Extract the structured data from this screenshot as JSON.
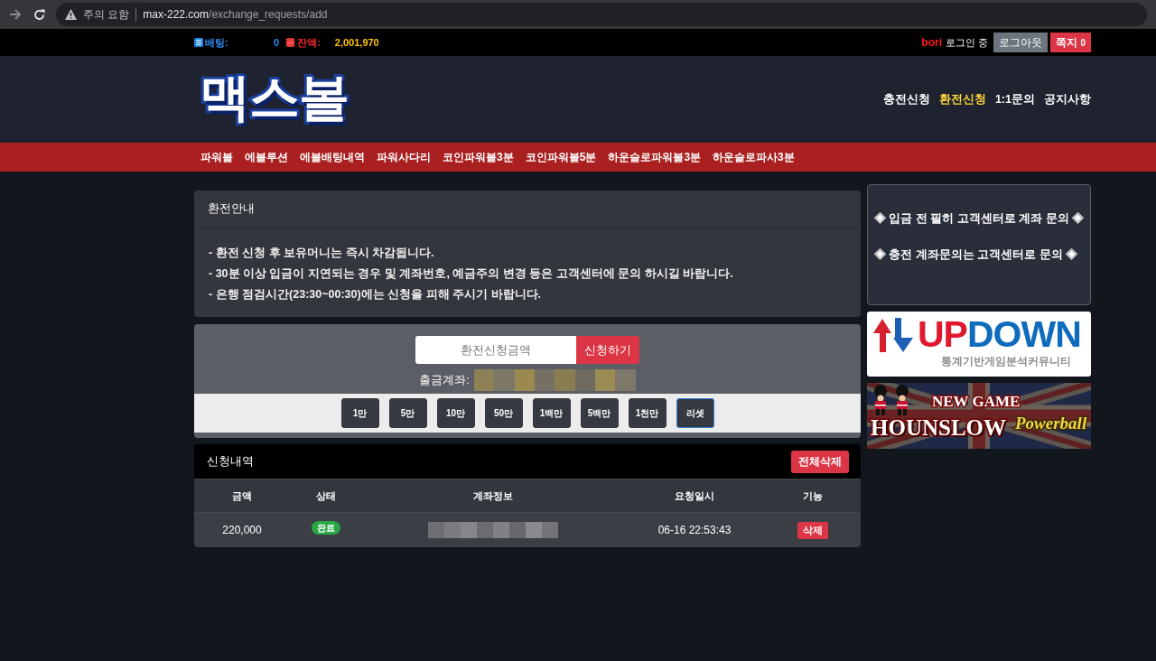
{
  "browser": {
    "security_label": "주의 요함",
    "url": {
      "host": "max-222.com",
      "path": "/exchange_requests/add"
    }
  },
  "top_bar": {
    "betting": {
      "label": "배팅:",
      "value": "0"
    },
    "balance": {
      "label": "잔액:",
      "value": "2,001,970"
    },
    "user": {
      "name": "bori",
      "status": "로그인 중"
    },
    "logout_button": "로그아웃",
    "messages_button": {
      "label": "쪽지",
      "count": "0"
    }
  },
  "header": {
    "logo": "맥스볼",
    "nav": [
      {
        "label": "충전신청",
        "selected": false
      },
      {
        "label": "환전신청",
        "selected": true
      },
      {
        "label": "1:1문의",
        "selected": false
      },
      {
        "label": "공지사항",
        "selected": false
      }
    ]
  },
  "menu": [
    "파워볼",
    "에볼루션",
    "에볼배팅내역",
    "파워사다리",
    "코인파워볼3분",
    "코인파워볼5분",
    "하운슬로파워볼3분",
    "하운슬로파사3분"
  ],
  "notice": {
    "title": "환전안내",
    "lines": [
      "- 환전 신청 후 보유머니는 즉시 차감됩니다.",
      "- 30분 이상 입금이 지연되는 경우 및 계좌번호, 예금주의 변경 등은 고객센터에 문의 하시길 바랍니다.",
      "- 은행 점검시간(23:30~00:30)에는 신청을 피해 주시기 바랍니다."
    ]
  },
  "exchange_form": {
    "amount_field": {
      "placeholder": "환전신청금액"
    },
    "submit_button": "신청하기",
    "account_label": "출금계좌:",
    "quick_buttons": [
      {
        "label": "1만",
        "kind": "amount"
      },
      {
        "label": "5만",
        "kind": "amount"
      },
      {
        "label": "10만",
        "kind": "amount"
      },
      {
        "label": "50만",
        "kind": "amount"
      },
      {
        "label": "1백만",
        "kind": "amount"
      },
      {
        "label": "5백만",
        "kind": "amount"
      },
      {
        "label": "1천만",
        "kind": "amount"
      },
      {
        "label": "리셋",
        "kind": "reset"
      }
    ]
  },
  "history": {
    "title": "신청내역",
    "delete_all_button": "전체삭제",
    "columns": [
      "금액",
      "상태",
      "계좌정보",
      "요청일시",
      "기능"
    ],
    "rows": [
      {
        "amount": "220,000",
        "status": {
          "label": "완료",
          "kind": "complete"
        },
        "requested_at": "06-16 22:53:43",
        "delete_button": "삭제"
      }
    ]
  },
  "sidebar": {
    "notices": [
      "◈ 입금 전 필히 고객센터로 계좌 문의 ◈",
      "◈ 충전 계좌문의는 고객센터로 문의 ◈"
    ],
    "banners": [
      {
        "kind": "community",
        "title_parts": [
          "UP",
          "DOWN"
        ],
        "subtitle": "통계기반게임분석커뮤니티"
      },
      {
        "kind": "game",
        "tagline": "NEW GAME",
        "title": "HOUNSLOW",
        "subtitle": "Powerball"
      }
    ]
  }
}
